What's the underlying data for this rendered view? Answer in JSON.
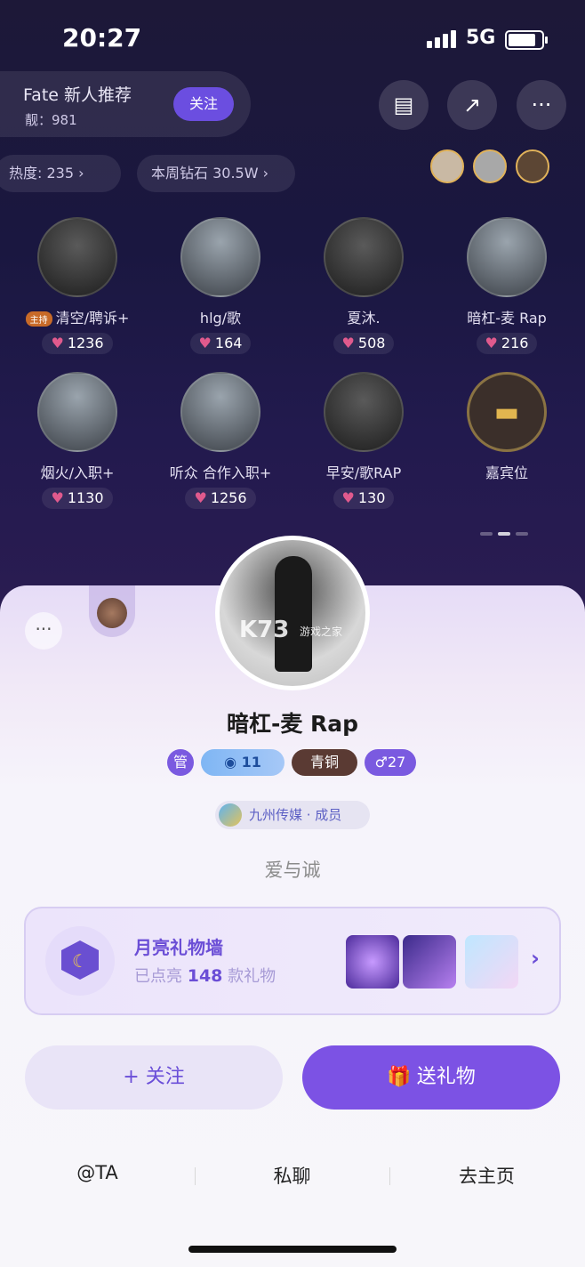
{
  "status_bar": {
    "time": "20:27",
    "network": "5G"
  },
  "room": {
    "name": "Fate 新人推荐",
    "id_label": "靓：981",
    "follow_label": "关注"
  },
  "chips": {
    "heat": "热度: 235 ›",
    "diamonds": "本周钻石 30.5W ›"
  },
  "top_icons": [
    "clipboard-icon",
    "share-icon",
    "more-icon"
  ],
  "seats": [
    {
      "name": "清空/聘诉+",
      "host_tag": "主持",
      "hearts": "1236"
    },
    {
      "name": "hlg/歌",
      "hearts": "164"
    },
    {
      "name": "夏沐.",
      "hearts": "508"
    },
    {
      "name": "暗杠-麦 Rap",
      "hearts": "216"
    },
    {
      "name": "烟火/入职+",
      "hearts": "1130"
    },
    {
      "name": "听众 合作入职+",
      "hearts": "1256"
    },
    {
      "name": "早安/歌RAP",
      "hearts": "130"
    },
    {
      "name": "嘉宾位"
    }
  ],
  "profile": {
    "name": "暗杠-麦 Rap",
    "admin_tag": "管",
    "level": "11",
    "rank": "青铜",
    "fans": "♂27",
    "club": "九州传媒 · 成员",
    "signature": "爱与诚",
    "watermark": "K73",
    "watermark_sub": "游戏之家",
    "more": "···"
  },
  "gift_wall": {
    "title": "月亮礼物墙",
    "prefix": "已点亮",
    "count": "148",
    "suffix": "款礼物"
  },
  "actions": {
    "follow": "+ 关注",
    "gift": "送礼物"
  },
  "links": [
    "@TA",
    "私聊",
    "去主页"
  ]
}
